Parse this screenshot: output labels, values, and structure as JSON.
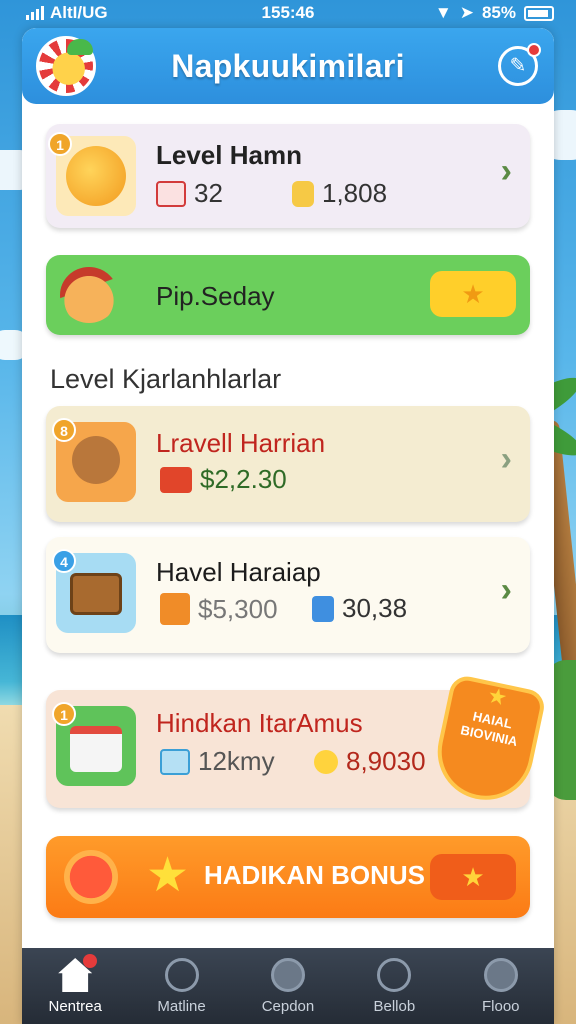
{
  "status_bar": {
    "carrier": "AltI/UG",
    "time": "155:46",
    "battery": "85%"
  },
  "header": {
    "title": "Napkuukimilari"
  },
  "cards": {
    "level_main": {
      "badge": "1",
      "title": "Level Hamn",
      "stat1": "32",
      "stat2": "1,808"
    },
    "promo": {
      "label": "Pip.Seday"
    },
    "section_title": "Level Kjarlanhlarlar",
    "item1": {
      "badge": "8",
      "title": "Lravell Harrian",
      "value": "$2,2.30"
    },
    "item2": {
      "badge": "4",
      "title": "Havel Haraiap",
      "value": "$5,300",
      "value2": "30,38"
    },
    "item3": {
      "title": "Hindkan ItarAmus",
      "stat1": "12kmy",
      "stat2": "8,9030",
      "ribbon": "HAIAL BIOVINIA"
    },
    "bonus": {
      "label": "HADIKAN BONUS"
    }
  },
  "colors": {
    "header_blue": "#2d8fdd",
    "promo_green": "#6bcf5c",
    "bonus_orange": "#fb7b15",
    "title_red": "#c0251e"
  },
  "bottom_nav": [
    {
      "label": "Nentrea",
      "icon": "home-icon"
    },
    {
      "label": "Matline",
      "icon": "user-icon"
    },
    {
      "label": "Cepdon",
      "icon": "tools-icon"
    },
    {
      "label": "Bellob",
      "icon": "globe-icon"
    },
    {
      "label": "Flooo",
      "icon": "profile-icon"
    }
  ]
}
